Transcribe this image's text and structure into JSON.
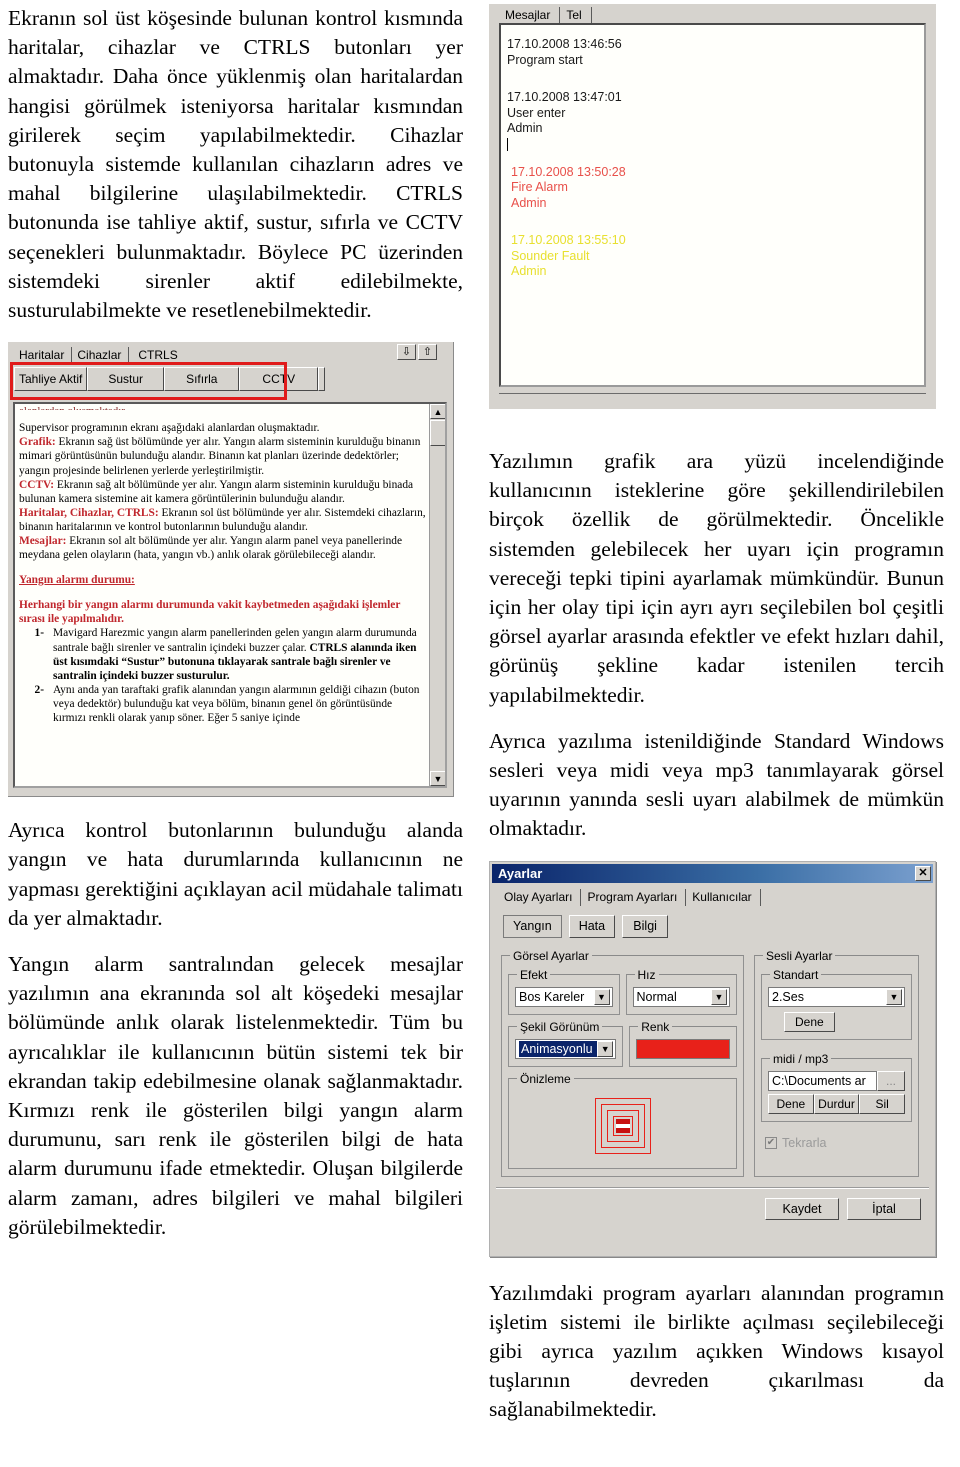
{
  "left_column": {
    "paragraph_1": "Ekranın sol üst köşesinde bulunan kontrol kısmında haritalar, cihazlar ve CTRLS butonları yer almaktadır. Daha önce yüklenmiş olan haritalardan hangisi görülmek isteniyorsa haritalar kısmından girilerek seçim yapılabilmektedir. Cihazlar butonuyla sistemde kullanılan cihazların adres ve mahal bilgilerine ulaşılabilmektedir. CTRLS butonunda ise tahliye aktif, sustur, sıfırla ve CCTV seçenekleri bulunmaktadır. Böylece PC üzerinden sistemdeki sirenler aktif edilebilmekte, susturulabilmekte ve resetlenebilmektedir.",
    "paragraph_2": "Ayrıca kontrol butonlarının bulunduğu alanda yangın ve hata durumlarında kullanıcının ne yapması gerektiğini açıklayan acil müdahale talimatı da yer almaktadır.",
    "paragraph_3": "Yangın alarm santralından gelecek mesajlar yazılımın ana ekranında sol alt köşedeki mesajlar bölümünde anlık olarak listelenmektedir. Tüm bu ayrıcalıklar ile kullanıcının bütün sistemi tek bir ekrandan takip edebilmesine olanak sağlanmaktadır. Kırmızı renk ile gösterilen bilgi yangın alarm durumunu, sarı renk ile gösterilen bilgi de hata alarm durumunu ifade etmektedir. Oluşan bilgilerde alarm zamanı, adres bilgileri ve mahal bilgileri görülebilmektedir."
  },
  "right_column": {
    "paragraph_1": "Yazılımın grafik ara yüzü incelendiğinde kullanıcının isteklerine göre şekillendirilebilen birçok özellik de görülmektedir. Öncelikle sistemden gelebilecek her uyarı için programın vereceği tepki tipini ayarlamak mümkündür. Bunun için her olay tipi için ayrı ayrı seçilebilen bol çeşitli görsel ayarlar arasında efektler ve efekt hızları dahil, görünüş şekline kadar istenilen tercih yapılabilmektedir.",
    "paragraph_2": "Ayrıca yazılıma istenildiğinde Standard Windows sesleri veya midi veya mp3 tanımlayarak görsel uyarının yanında sesli uyarı alabilmek de mümkün olmaktadır.",
    "paragraph_3": "Yazılımdaki program ayarları alanından programın işletim sistemi ile birlikte açılması seçilebileceği gibi ayrıca yazılım açıkken Windows kısayol tuşlarının devreden çıkarılması da sağlanabilmektedir."
  },
  "messages_panel": {
    "tabs": [
      "Mesajlar",
      "Tel"
    ],
    "entries": [
      {
        "time": "17.10.2008 13:46:56",
        "event": "Program start",
        "user": "",
        "color": "#1a1a1a"
      },
      {
        "time": "17.10.2008 13:47:01",
        "event": "User enter",
        "user": "Admin",
        "color": "#1a1a1a"
      },
      {
        "time": "17.10.2008 13:50:28",
        "event": "Fire Alarm",
        "user": "Admin",
        "color": "#e8504a"
      },
      {
        "time": "17.10.2008 13:55:10",
        "event": "Sounder Fault",
        "user": "Admin",
        "color": "#e8e030"
      }
    ]
  },
  "ctrls_panel": {
    "tabs": [
      "Haritalar",
      "Cihazlar",
      "CTRLS"
    ],
    "selected_tab": "CTRLS",
    "buttons": [
      "Tahliye Aktif",
      "Sustur",
      "Sıfırla",
      "CCTV"
    ],
    "scroll_down_icon": "⇩",
    "scroll_up_icon": "⇧",
    "highlight_color": "#e01b1b",
    "document": {
      "clipped_line": "alanlardan oluşmaktadır.",
      "intro": "Supervisor programının ekranı aşağıdaki alanlardan oluşmaktadır.",
      "sections": [
        {
          "label": "Grafik:",
          "text": " Ekranın sağ üst bölümünde yer alır. Yangın alarm sisteminin kurulduğu binanın mimari görüntüsünün bulunduğu alandır. Binanın kat planları üzerinde dedektörler; yangın projesinde belirlenen yerlerde yerleştirilmiştir."
        },
        {
          "label": "CCTV:",
          "text": " Ekranın sağ alt bölümünde yer alır. Yangın alarm sisteminin kurulduğu binada  bulunan kamera sistemine ait kamera görüntülerinin bulunduğu alandır."
        },
        {
          "label": "Haritalar, Cihazlar, CTRLS:",
          "text": " Ekranın sol üst bölümünde yer alır. Sistemdeki cihazların, binanın haritalarının ve kontrol butonlarının bulunduğu alandır."
        },
        {
          "label": "Mesajlar:",
          "text": " Ekranın sol alt bölümünde yer alır. Yangın alarm panel veya panellerinde meydana gelen olayların (hata, yangın vb.) anlık olarak görülebileceği alandır."
        }
      ],
      "alarm_heading": "Yangın alarmı durumu:",
      "alarm_intro": "Herhangi bir yangın alarmı durumunda vakit kaybetmeden aşağıdaki işlemler sırası ile yapılmalıdır.",
      "steps": [
        {
          "n": "1-",
          "text": "Mavigard Harezmic yangın alarm panellerinden gelen yangın alarm durumunda santrale bağlı sirenler ve santralin içindeki buzzer çalar. ",
          "bold": "CTRLS alanında iken üst kısımdaki “Sustur” butonuna tıklayarak santrale bağlı sirenler ve santralin içindeki buzzer susturulur."
        },
        {
          "n": "2-",
          "text": "Aynı anda yan taraftaki grafik alanından yangın alarmının geldiği cihazın (buton veya dedektör) bulunduğu kat veya bölüm, binanın genel ön görüntüsünde kırmızı renkli olarak yanıp söner. Eğer 5 saniye içinde",
          "bold": ""
        }
      ]
    }
  },
  "settings_dialog": {
    "title": "Ayarlar",
    "close_label": "✕",
    "tabs": [
      "Olay Ayarları",
      "Program Ayarları",
      "Kullanıcılar"
    ],
    "selected_tab": "Olay Ayarları",
    "event_buttons": [
      "Yangın",
      "Hata",
      "Bilgi"
    ],
    "selected_event": "Yangın",
    "visual_group": {
      "legend": "Görsel Ayarlar",
      "effect": {
        "legend": "Efekt",
        "value": "Bos Kareler"
      },
      "speed": {
        "legend": "Hız",
        "value": "Normal"
      },
      "shape": {
        "legend": "Şekil Görünüm",
        "value": "Animasyonlu"
      },
      "color": {
        "legend": "Renk",
        "value": "#e8211a"
      },
      "preview": {
        "legend": "Önizleme"
      }
    },
    "sound_group": {
      "legend": "Sesli Ayarlar",
      "standard": {
        "legend": "Standart",
        "value": "2.Ses",
        "test_label": "Dene"
      },
      "midi": {
        "legend": "midi / mp3",
        "path": "C:\\Documents ar",
        "browse_label": "...",
        "buttons": [
          "Dene",
          "Durdur",
          "Sil"
        ]
      },
      "repeat": {
        "label": "Tekrarla",
        "checked": true,
        "check_glyph": "✔"
      }
    },
    "footer_buttons": [
      "Kaydet",
      "İptal"
    ],
    "dropdown_arrow": "▼"
  }
}
